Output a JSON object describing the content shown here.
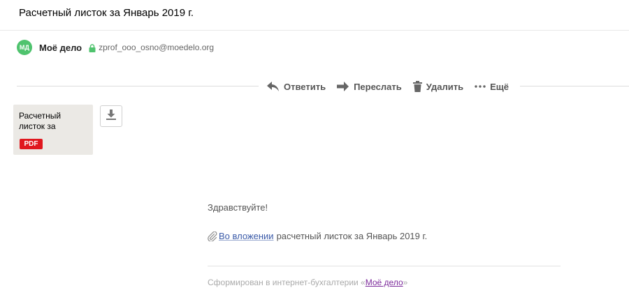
{
  "message": {
    "subject": "Расчетный листок за Январь 2019 г."
  },
  "sender": {
    "avatar_initials": "МД",
    "avatar_color": "#4fc36e",
    "name": "Моё дело",
    "email": "zprof_ooo_osno@moedelo.org",
    "lock_icon": "lock-icon"
  },
  "actions": {
    "reply": "Ответить",
    "forward": "Переслать",
    "delete": "Удалить",
    "more": "Ещё"
  },
  "attachment": {
    "name": "Расчетный листок за",
    "type_badge": "PDF",
    "badge_color": "#e0171e"
  },
  "body": {
    "greeting": "Здравствуйте!",
    "attachment_link": "Во вложении",
    "attachment_text": "расчетный листок за Январь 2019 г.",
    "footer_prefix": "Сформирован в интернет-бухгалтерии «",
    "footer_link": "Моё дело",
    "footer_suffix": "»"
  }
}
